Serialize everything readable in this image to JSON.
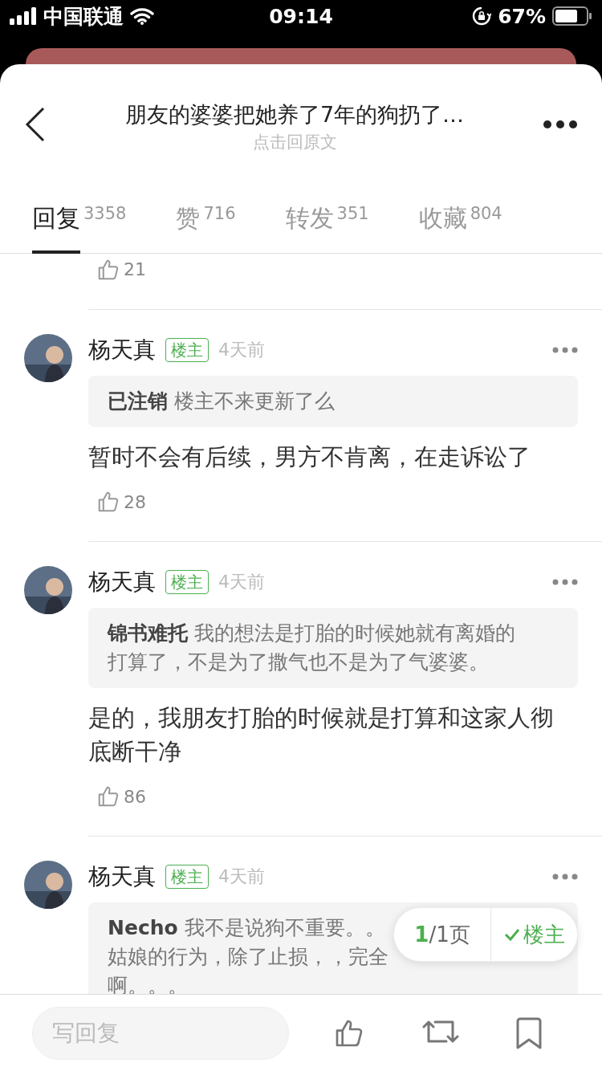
{
  "status_bar": {
    "carrier": "中国联通",
    "time": "09:14",
    "battery": "67%"
  },
  "header": {
    "title": "朋友的婆婆把她养了7年的狗扔了…",
    "subtitle": "点击回原文"
  },
  "tabs": [
    {
      "label": "回复",
      "count": "3358",
      "selected": true
    },
    {
      "label": "赞",
      "count": "716",
      "selected": false
    },
    {
      "label": "转发",
      "count": "351",
      "selected": false
    },
    {
      "label": "收藏",
      "count": "804",
      "selected": false
    }
  ],
  "top_fragment": {
    "likes": "21"
  },
  "replies": [
    {
      "name": "杨天真",
      "badge": "楼主",
      "time": "4天前",
      "quote": {
        "author": "已注销",
        "lines": [
          "楼主不来更新了么"
        ]
      },
      "body": "暂时不会有后续，男方不肯离，在走诉讼了",
      "likes": "28"
    },
    {
      "name": "杨天真",
      "badge": "楼主",
      "time": "4天前",
      "quote": {
        "author": "锦书难托",
        "lines": [
          "我的想法是打胎的时候她就有离婚的",
          "打算了，不是为了撒气也不是为了气婆婆。"
        ]
      },
      "body": "是的，我朋友打胎的时候就是打算和这家人彻底断干净",
      "likes": "86"
    },
    {
      "name": "杨天真",
      "badge": "楼主",
      "time": "4天前",
      "quote": {
        "author": "Necho",
        "lines": [
          "我不是说狗不重要。。",
          "姑娘的行为，除了止损，，完全",
          "啊。。。"
        ]
      }
    }
  ],
  "pager": {
    "current": "1",
    "rest": "/1页",
    "filter": "楼主",
    "filter_on": true
  },
  "bottom_bar": {
    "placeholder": "写回复"
  }
}
